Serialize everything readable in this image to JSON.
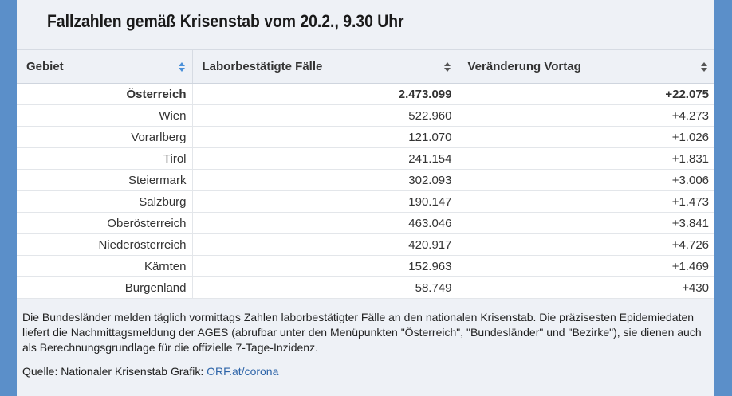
{
  "title": "Fallzahlen gemäß Krisenstab vom 20.2., 9.30 Uhr",
  "table": {
    "headers": [
      "Gebiet",
      "Laborbestätigte Fälle",
      "Veränderung Vortag"
    ],
    "rows": [
      [
        "Österreich",
        "2.473.099",
        "+22.075"
      ],
      [
        "Wien",
        "522.960",
        "+4.273"
      ],
      [
        "Vorarlberg",
        "121.070",
        "+1.026"
      ],
      [
        "Tirol",
        "241.154",
        "+1.831"
      ],
      [
        "Steiermark",
        "302.093",
        "+3.006"
      ],
      [
        "Salzburg",
        "190.147",
        "+1.473"
      ],
      [
        "Oberösterreich",
        "463.046",
        "+3.841"
      ],
      [
        "Niederösterreich",
        "420.917",
        "+4.726"
      ],
      [
        "Kärnten",
        "152.963",
        "+1.469"
      ],
      [
        "Burgenland",
        "58.749",
        "+430"
      ]
    ]
  },
  "note": "Die Bundesländer melden täglich vormittags Zahlen laborbestätigter Fälle an den nationalen Krisenstab. Die präzisesten Epidemiedaten liefert die Nachmittagsmeldung der AGES (abrufbar unter den Menüpunkten \"Österreich\", \"Bundesländer\" und \"Bezirke\"), sie dienen auch als Berechnungsgrundlage für die offizielle 7-Tage-Inzidenz.",
  "source": {
    "prefix": "Quelle: Nationaler Krisenstab Grafik: ",
    "link_text": "ORF.at/corona"
  },
  "colors": {
    "frame_blue": "#5b8fc9",
    "panel_bg": "#eef1f6",
    "sort_active": "#4a90d9",
    "link": "#2d64a8"
  }
}
